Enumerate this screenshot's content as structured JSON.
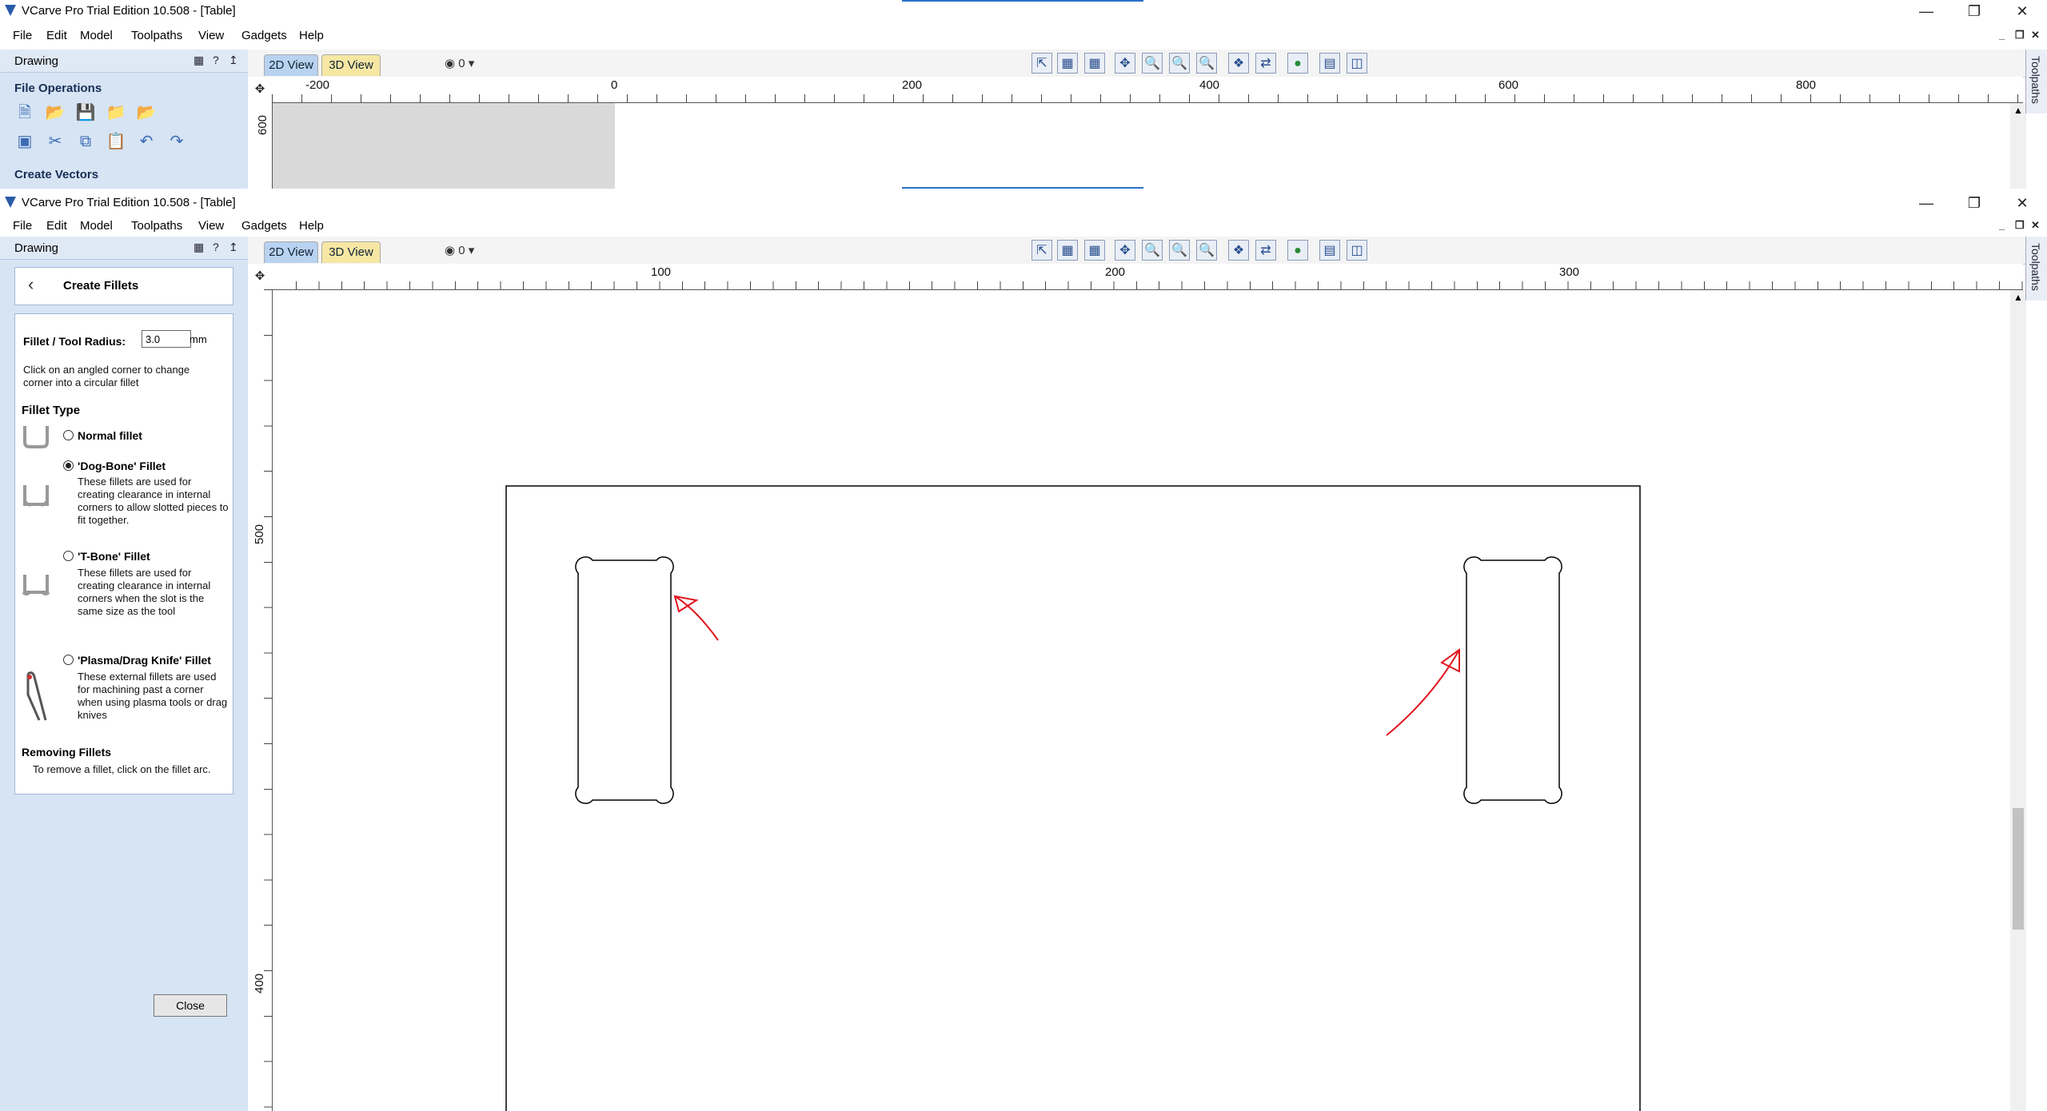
{
  "background_window": {
    "title": "VCarve Pro Trial Edition 10.508 - [Table]",
    "menu": [
      "File",
      "Edit",
      "Model",
      "Toolpaths",
      "View",
      "Gadgets",
      "Help"
    ],
    "sidebar_label": "Drawing",
    "file_operations_title": "File Operations",
    "create_vectors_title": "Create Vectors",
    "tab_2d": "2D View",
    "tab_3d": "3D View",
    "layer_value": "0",
    "ruler_h_labels": [
      "-200",
      "0",
      "200",
      "400",
      "600",
      "800"
    ],
    "ruler_v_label": "600",
    "toolpaths_tab": "Toolpaths"
  },
  "main_window": {
    "title": "VCarve Pro Trial Edition 10.508 - [Table]",
    "menu": [
      "File",
      "Edit",
      "Model",
      "Toolpaths",
      "View",
      "Gadgets",
      "Help"
    ],
    "sidebar_label": "Drawing",
    "tab_2d": "2D View",
    "tab_3d": "3D View",
    "layer_value": "0",
    "ruler_h_labels": [
      "100",
      "200",
      "300"
    ],
    "ruler_v_labels": [
      "500",
      "400"
    ],
    "toolpaths_tab": "Toolpaths",
    "fillet_panel": {
      "header": "Create Fillets",
      "radius_label": "Fillet / Tool Radius:",
      "radius_value": "3.0",
      "radius_unit": "mm",
      "instruction": "Click on an angled corner to change corner into a circular fillet",
      "fillet_type_title": "Fillet Type",
      "options": [
        {
          "label": "Normal fillet",
          "selected": false,
          "description": ""
        },
        {
          "label": "'Dog-Bone' Fillet",
          "selected": true,
          "description": "These fillets are used for creating clearance in internal corners to allow slotted pieces to fit together."
        },
        {
          "label": "'T-Bone' Fillet",
          "selected": false,
          "description": "These fillets are used for creating clearance in internal corners when the slot is the same size as the tool"
        },
        {
          "label": "'Plasma/Drag Knife' Fillet",
          "selected": false,
          "description": "These external fillets are used for machining past a corner when using plasma tools or drag knives"
        }
      ],
      "removing_title": "Removing Fillets",
      "removing_text": "To remove a fillet, click on the fillet arc.",
      "close_label": "Close"
    }
  },
  "colors": {
    "sidebar_bg": "#d6e4f4",
    "annotation_arrow": "#e0141c",
    "tab_2d": "#b8d2f0",
    "tab_3d": "#f6e7a3"
  }
}
